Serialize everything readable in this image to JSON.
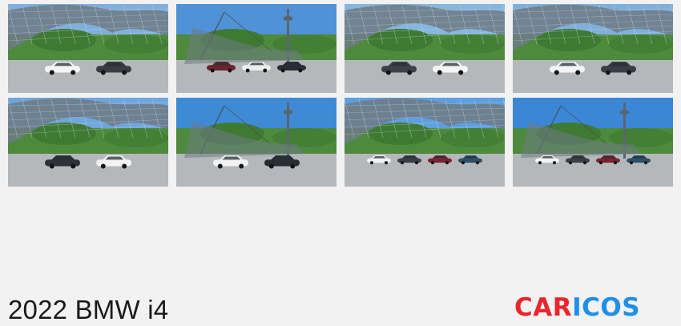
{
  "page": {
    "title": "2022 BMW i4"
  },
  "logo": {
    "part1": "CAR",
    "part2": "ICOS",
    "colors": {
      "red": "#e8262c",
      "blue": "#1e90e8"
    }
  },
  "gallery": {
    "thumbnails": [
      {
        "name": "white-i4-grey-ix-under-canopy",
        "scene": "canopy",
        "sky": "#7fb0dc",
        "cars": [
          "#f4f4f4",
          "#3a3d44"
        ]
      },
      {
        "name": "tower-three-cars-wide",
        "scene": "tower",
        "sky": "#4f92d6",
        "cars": [
          "#6b2330",
          "#eeeeee",
          "#2b2d33"
        ]
      },
      {
        "name": "grey-ix-white-i4-canopy",
        "scene": "canopy",
        "sky": "#86b6de",
        "cars": [
          "#3d4048",
          "#f5f5f5"
        ]
      },
      {
        "name": "white-i4-grey-ix-front",
        "scene": "canopy",
        "sky": "#7fb0dc",
        "cars": [
          "#f4f4f4",
          "#3a3d44"
        ]
      },
      {
        "name": "dark-ix-white-i4-side",
        "scene": "canopy",
        "sky": "#6fa6dc",
        "cars": [
          "#2e3138",
          "#f3f3f3"
        ]
      },
      {
        "name": "white-i4-dark-ix-tower",
        "scene": "tower",
        "sky": "#3f8ad4",
        "cars": [
          "#f2f2f2",
          "#2a2c31"
        ]
      },
      {
        "name": "four-cars-lineup-canopy",
        "scene": "canopy",
        "sky": "#5d9fdf",
        "cars": [
          "#f2f2f2",
          "#3b3e46",
          "#7a2230",
          "#2d4f6a"
        ]
      },
      {
        "name": "four-cars-olympic-tower",
        "scene": "tower",
        "sky": "#3b87d6",
        "cars": [
          "#f3f3f3",
          "#3b3e46",
          "#7a2230",
          "#2d4f6a"
        ]
      }
    ]
  }
}
